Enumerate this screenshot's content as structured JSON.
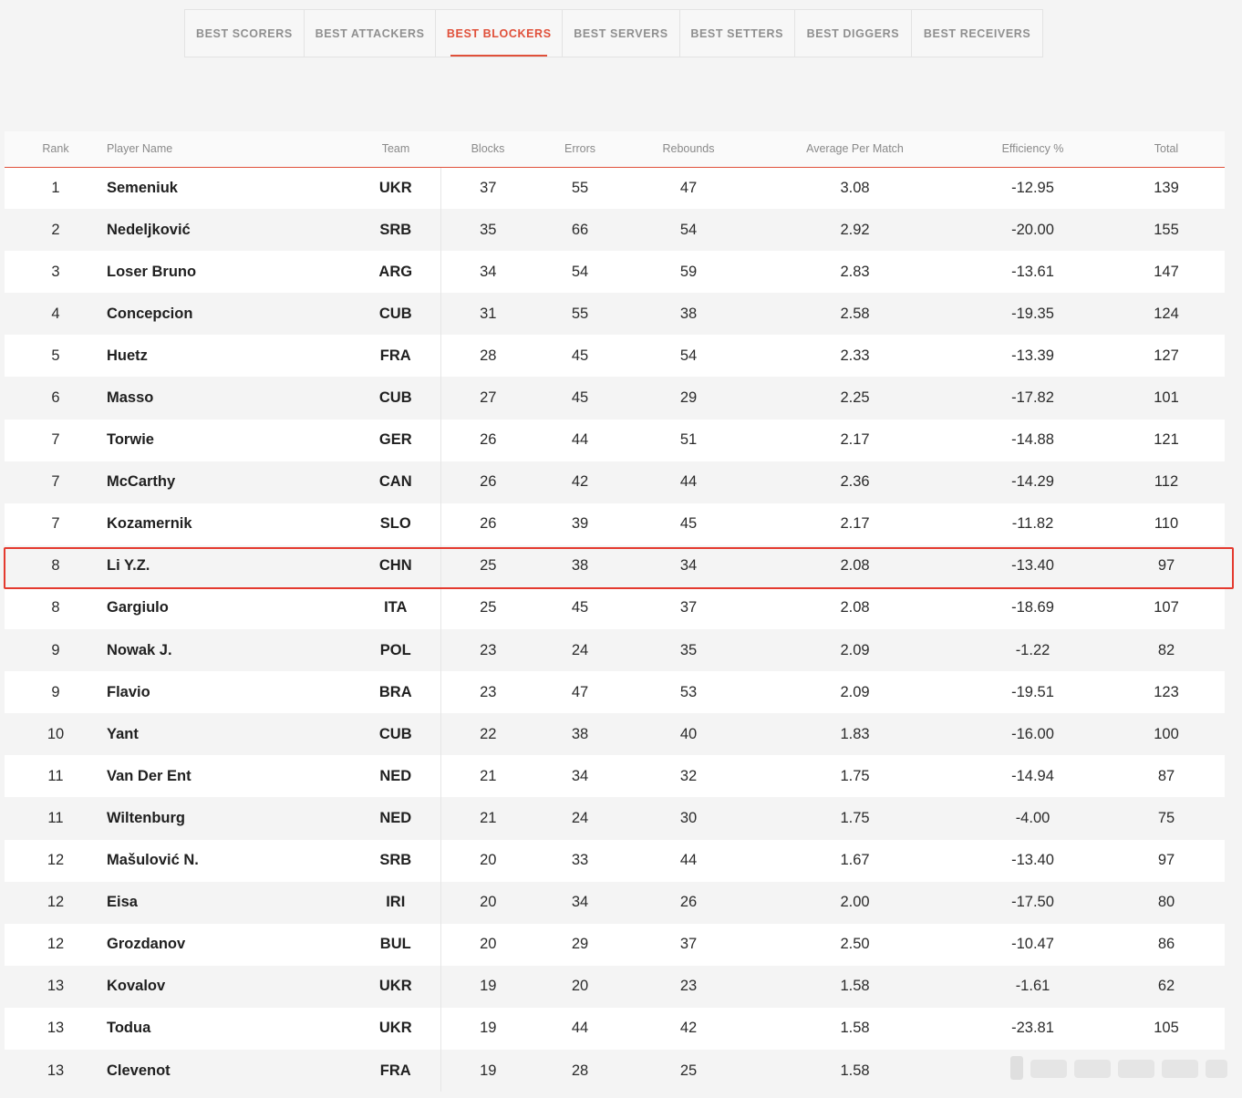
{
  "tabs": [
    {
      "label": "BEST SCORERS",
      "active": false
    },
    {
      "label": "BEST ATTACKERS",
      "active": false
    },
    {
      "label": "BEST BLOCKERS",
      "active": true
    },
    {
      "label": "BEST SERVERS",
      "active": false
    },
    {
      "label": "BEST SETTERS",
      "active": false
    },
    {
      "label": "BEST DIGGERS",
      "active": false
    },
    {
      "label": "BEST RECEIVERS",
      "active": false
    }
  ],
  "table": {
    "columns": [
      "Rank",
      "Player Name",
      "Team",
      "Blocks",
      "Errors",
      "Rebounds",
      "Average Per Match",
      "Efficiency %",
      "Total"
    ],
    "rows": [
      [
        "1",
        "Semeniuk",
        "UKR",
        "37",
        "55",
        "47",
        "3.08",
        "-12.95",
        "139"
      ],
      [
        "2",
        "Nedeljković",
        "SRB",
        "35",
        "66",
        "54",
        "2.92",
        "-20.00",
        "155"
      ],
      [
        "3",
        "Loser Bruno",
        "ARG",
        "34",
        "54",
        "59",
        "2.83",
        "-13.61",
        "147"
      ],
      [
        "4",
        "Concepcion",
        "CUB",
        "31",
        "55",
        "38",
        "2.58",
        "-19.35",
        "124"
      ],
      [
        "5",
        "Huetz",
        "FRA",
        "28",
        "45",
        "54",
        "2.33",
        "-13.39",
        "127"
      ],
      [
        "6",
        "Masso",
        "CUB",
        "27",
        "45",
        "29",
        "2.25",
        "-17.82",
        "101"
      ],
      [
        "7",
        "Torwie",
        "GER",
        "26",
        "44",
        "51",
        "2.17",
        "-14.88",
        "121"
      ],
      [
        "7",
        "McCarthy",
        "CAN",
        "26",
        "42",
        "44",
        "2.36",
        "-14.29",
        "112"
      ],
      [
        "7",
        "Kozamernik",
        "SLO",
        "26",
        "39",
        "45",
        "2.17",
        "-11.82",
        "110"
      ],
      [
        "8",
        "Li Y.Z.",
        "CHN",
        "25",
        "38",
        "34",
        "2.08",
        "-13.40",
        "97"
      ],
      [
        "8",
        "Gargiulo",
        "ITA",
        "25",
        "45",
        "37",
        "2.08",
        "-18.69",
        "107"
      ],
      [
        "9",
        "Nowak J.",
        "POL",
        "23",
        "24",
        "35",
        "2.09",
        "-1.22",
        "82"
      ],
      [
        "9",
        "Flavio",
        "BRA",
        "23",
        "47",
        "53",
        "2.09",
        "-19.51",
        "123"
      ],
      [
        "10",
        "Yant",
        "CUB",
        "22",
        "38",
        "40",
        "1.83",
        "-16.00",
        "100"
      ],
      [
        "11",
        "Van Der Ent",
        "NED",
        "21",
        "34",
        "32",
        "1.75",
        "-14.94",
        "87"
      ],
      [
        "11",
        "Wiltenburg",
        "NED",
        "21",
        "24",
        "30",
        "1.75",
        "-4.00",
        "75"
      ],
      [
        "12",
        "Mašulović N.",
        "SRB",
        "20",
        "33",
        "44",
        "1.67",
        "-13.40",
        "97"
      ],
      [
        "12",
        "Eisa",
        "IRI",
        "20",
        "34",
        "26",
        "2.00",
        "-17.50",
        "80"
      ],
      [
        "12",
        "Grozdanov",
        "BUL",
        "20",
        "29",
        "37",
        "2.50",
        "-10.47",
        "86"
      ],
      [
        "13",
        "Kovalov",
        "UKR",
        "19",
        "20",
        "23",
        "1.58",
        "-1.61",
        "62"
      ],
      [
        "13",
        "Todua",
        "UKR",
        "19",
        "44",
        "42",
        "1.58",
        "-23.81",
        "105"
      ],
      [
        "13",
        "Clevenot",
        "FRA",
        "19",
        "28",
        "25",
        "1.58",
        "",
        ""
      ]
    ]
  },
  "colors": {
    "accent": "#e0503a",
    "highlight_border": "#e43a2f"
  }
}
